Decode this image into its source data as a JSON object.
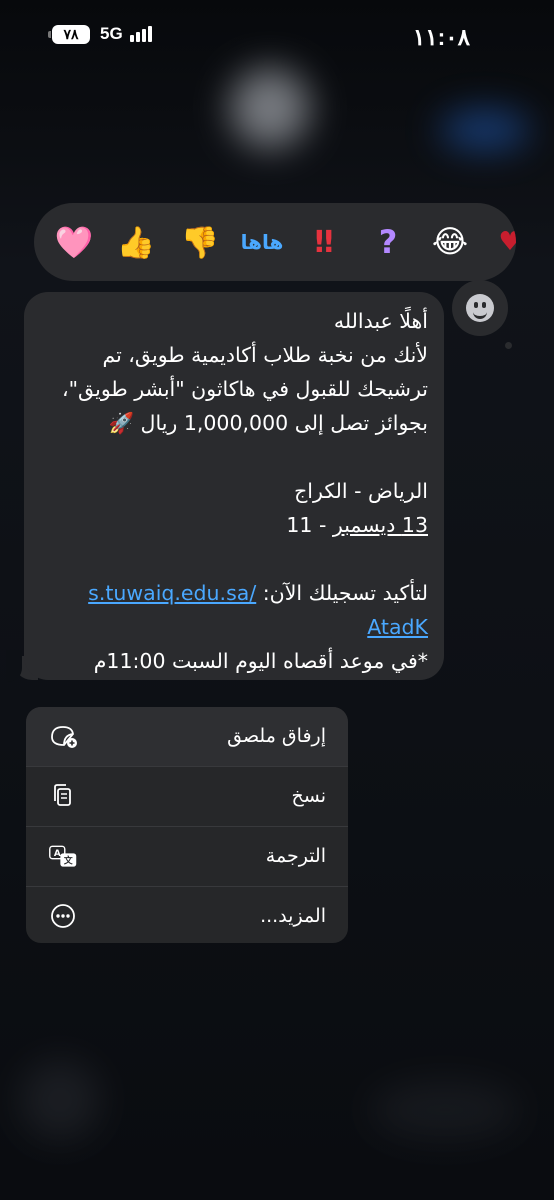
{
  "status_bar": {
    "time": "١١:٠٨",
    "battery": "٧٨",
    "network": "5G"
  },
  "reactions": [
    {
      "name": "heart",
      "glyph": "🩷"
    },
    {
      "name": "thumbs-up",
      "glyph": "👍"
    },
    {
      "name": "thumbs-down",
      "glyph": "👎"
    },
    {
      "name": "haha",
      "glyph": "هاها"
    },
    {
      "name": "exclamation",
      "glyph": "‼"
    },
    {
      "name": "question",
      "glyph": "?"
    },
    {
      "name": "laughing",
      "glyph": "😂"
    },
    {
      "name": "partial",
      "glyph": "♥"
    }
  ],
  "message": {
    "line1": "أهلًا عبدالله",
    "line2": "لأنك من نخبة طلاب أكاديمية طويق، تم",
    "line3": "ترشيحك للقبول في هاكاثون \"أبشر طويق\"،",
    "line4": "بجوائز تصل إلى 1,000,000 ريال 🚀",
    "line5": "الرياض - الكراج",
    "line6_prefix": "11 - ",
    "line6_underlined": "13 ديسمبر",
    "line7_text": "لتأكيد تسجيلك الآن: ",
    "link_part1": "s.tuwaiq.edu.sa/",
    "link_part2": "AtadK",
    "line9": "*في موعد أقصاه اليوم السبت 11:00م"
  },
  "menu": {
    "items": [
      {
        "label": "إرفاق ملصق",
        "icon": "sticker-add-icon"
      },
      {
        "label": "نسخ",
        "icon": "copy-icon"
      },
      {
        "label": "الترجمة",
        "icon": "translate-icon"
      },
      {
        "label": "المزيد...",
        "icon": "more-icon"
      }
    ]
  },
  "colors": {
    "bubble": "#2a2b2e",
    "link": "#4aa8ff",
    "menu": "#262729"
  }
}
